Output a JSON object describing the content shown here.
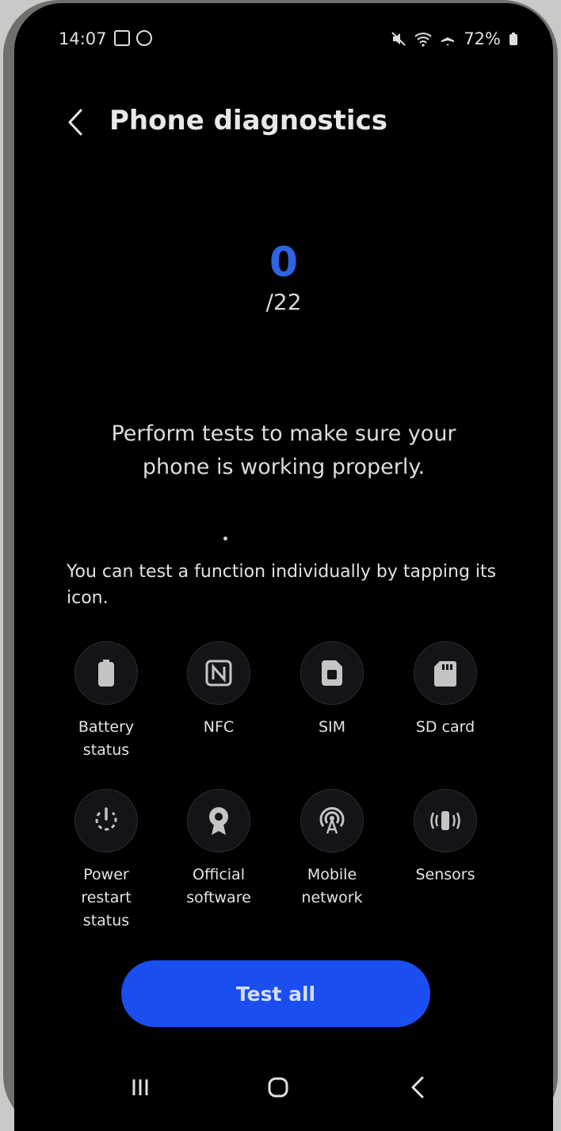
{
  "status_bar": {
    "time": "14:07",
    "battery": "72%",
    "left_icons": [
      "checkbox-icon",
      "circle-app-icon"
    ],
    "right_icons": [
      "mute-icon",
      "wifi-icon",
      "airplane-icon",
      "battery-icon"
    ]
  },
  "header": {
    "title": "Phone diagnostics",
    "back_icon": "chevron-left-icon"
  },
  "progress": {
    "passed": "0",
    "total": "/22"
  },
  "intro_text": "Perform tests to make sure your phone is working properly.",
  "hint_text": "You can test a function individually by tapping its icon.",
  "tests": [
    {
      "label": "Battery status",
      "icon": "battery-icon"
    },
    {
      "label": "NFC",
      "icon": "nfc-icon"
    },
    {
      "label": "SIM",
      "icon": "sim-icon"
    },
    {
      "label": "SD card",
      "icon": "sd-card-icon"
    },
    {
      "label": "Power restart status",
      "icon": "power-restart-icon"
    },
    {
      "label": "Official software",
      "icon": "badge-icon"
    },
    {
      "label": "Mobile network",
      "icon": "antenna-icon"
    },
    {
      "label": "Sensors",
      "icon": "vibration-icon"
    }
  ],
  "test_all_label": "Test all",
  "nav": {
    "recents_icon": "recents-icon",
    "home_icon": "home-icon",
    "back_icon": "back-icon"
  },
  "colors": {
    "accent": "#1a4ef0",
    "score": "#2e63e6",
    "background": "#000000"
  }
}
